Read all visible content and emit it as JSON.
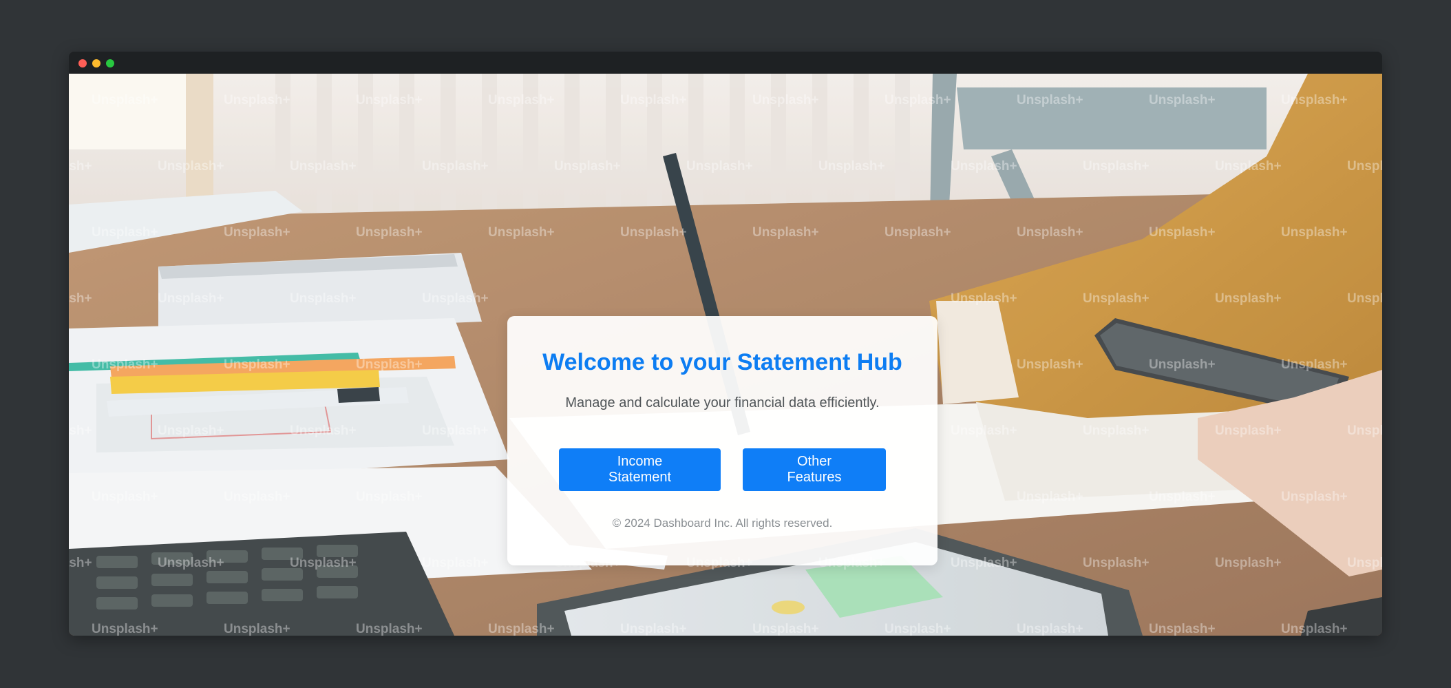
{
  "window": {
    "controls": [
      {
        "name": "close",
        "color": "#ff5f57"
      },
      {
        "name": "minimize",
        "color": "#febc2e"
      },
      {
        "name": "maximize",
        "color": "#28c840"
      }
    ]
  },
  "background": {
    "watermark_text": "Unsplash+"
  },
  "hero": {
    "title": "Welcome to your Statement Hub",
    "subtitle": "Manage and calculate your financial data efficiently.",
    "buttons": {
      "income": "Income Statement",
      "other": "Other Features"
    },
    "footer": "© 2024 Dashboard Inc. All rights reserved."
  },
  "colors": {
    "accent": "#0f7ef7",
    "title": "#0d7df2",
    "page_bg": "#303437"
  }
}
